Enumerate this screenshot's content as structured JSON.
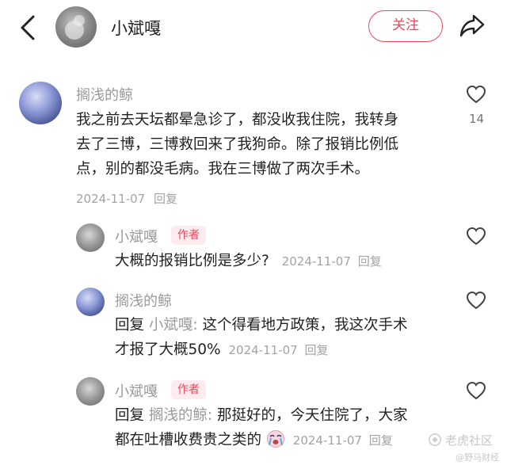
{
  "header": {
    "back_icon": "chevron-left-icon",
    "name": "小斌嘎",
    "follow_label": "关注",
    "share_icon": "share-icon",
    "accent": "#e8485a"
  },
  "comment": {
    "user": "搁浅的鲸",
    "text_line1": "我之前去天坛都晕急诊了，都没收我住院，我转身",
    "text_line2": "去了三博，三博救回来了我狗命。除了报销比例低",
    "text_line3": "点，别的都没毛病。我在三博做了两次手术。",
    "date": "2024-11-07",
    "reply_label": "回复",
    "likes": "14"
  },
  "replies": [
    {
      "user": "小斌嘎",
      "tag": "作者",
      "text": "大概的报销比例是多少?",
      "date": "2024-11-07",
      "reply_label": "回复"
    },
    {
      "user": "搁浅的鲸",
      "prefix": "回复",
      "target": "小斌嘎:",
      "text_line1": "这个得看地方政策，我这次手术",
      "text_line2": "才报了大概50%",
      "date": "2024-11-07",
      "reply_label": "回复"
    },
    {
      "user": "小斌嘎",
      "tag": "作者",
      "prefix": "回复",
      "target": "搁浅的鲸:",
      "text_line1": "那挺好的，今天住院了，大家",
      "text_line2": "都在吐槽收费贵之类的",
      "emoji": "crying-face-emoji",
      "date": "2024-11-07",
      "reply_label": "回复"
    }
  ],
  "watermark": {
    "main": "老虎社区",
    "sub": "@野马财经"
  }
}
